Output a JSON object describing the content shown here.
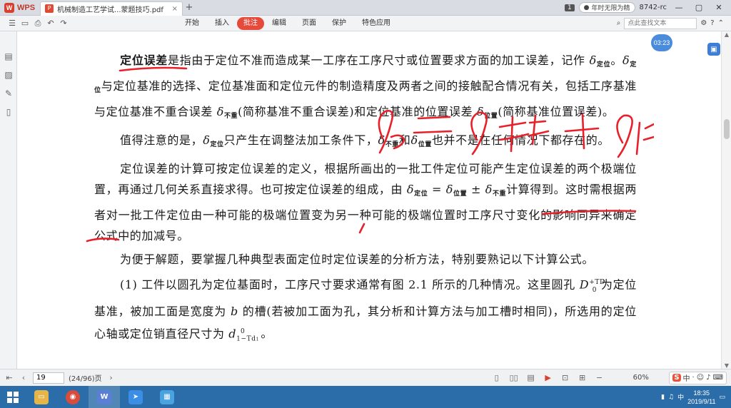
{
  "titlebar": {
    "app_name": "WPS",
    "tab_title": "机械制造工艺学试...蒙题技巧.pdf",
    "tab_close": "×",
    "add_tab": "+",
    "page_badge": "1",
    "user_label": "年时无限为精",
    "user_extra": "8742-rc",
    "min": "—",
    "max": "▢",
    "close": "✕"
  },
  "ribbon": {
    "menu": [
      "开始",
      "插入",
      "批注",
      "编辑",
      "页面",
      "保护",
      "特色应用"
    ],
    "active_index": 2,
    "search_placeholder": "点此查找文本"
  },
  "overlay": {
    "timer": "03:23",
    "cursor_text": "K)"
  },
  "document": {
    "p1_term": "定位误差",
    "p1_rest_a": "是指由于定位不准而造成某一工序在工序尺寸或位置要求方面的加工误差，记作",
    "sym_delta": "δ",
    "sub_dingwei": "定位",
    "sub_buchong": "不重",
    "sub_weizhi": "位置",
    "p1_rest_b": "。",
    "p1_rest_c": "与定位基准的选择、定位基准面和定位元件的制造精度及两者之间的接触配合情况有关，包括工序基准与定位基准不重合误差",
    "p1_rest_d": "(简称基准不重合误差)和定位基准的位置误差",
    "p1_rest_e": "(简称基准位置误差)。",
    "p2_a": "值得注意的是，",
    "p2_b": "只产生在调整法加工条件下，",
    "p2_c": "和",
    "p2_d": "也并不是在任何情况下都存在的。",
    "p3_a": "定位误差的计算可按定位误差的定义，根据所画出的一批工件定位可能产生定位误差的两个极端位置，再通过几何关系直接求得。也可按定位误差的组成，由",
    "p3_eq": " = ",
    "p3_pm": " ± ",
    "p3_b": "计算得到。这时需根据两者对一批工件定位由一种可能的极端位置变为另一种可能的极端位置时工序尺寸变化的影响同异来确定公式中的加减号。",
    "p4": "为便于解题，要掌握几种典型表面定位时定位误差的分析方法，特别要熟记以下计算公式。",
    "p5_a": "(1) 工件以圆孔为定位基面时，工序尺寸要求通常有图 2.1 所示的几种情况。这里圆孔",
    "p5_D": "D",
    "p5_D_sup": "+TD",
    "p5_D_sub": "0",
    "p5_b": "为定位基准，被加工面是宽度为",
    "p5_bsym": "b",
    "p5_c": "的槽(若被加工面为孔，其分析和计算方法与加工槽时相同)，所选用的定位心轴或定位销直径尺寸为",
    "p5_d": "d",
    "p5_d_sub": "1−Td",
    "p5_d_sub2": "1",
    "p5_d_sup": "0",
    "p5_end": "。"
  },
  "status": {
    "page_current": "19",
    "page_info": "(24/96)页",
    "zoom": "60%",
    "ime_label": "中"
  },
  "taskbar": {
    "time": "18:35",
    "date": "2019/9/11"
  },
  "colors": {
    "accent": "#e64a3b",
    "ink": "#e8202a",
    "taskbar": "#2b6da8"
  }
}
